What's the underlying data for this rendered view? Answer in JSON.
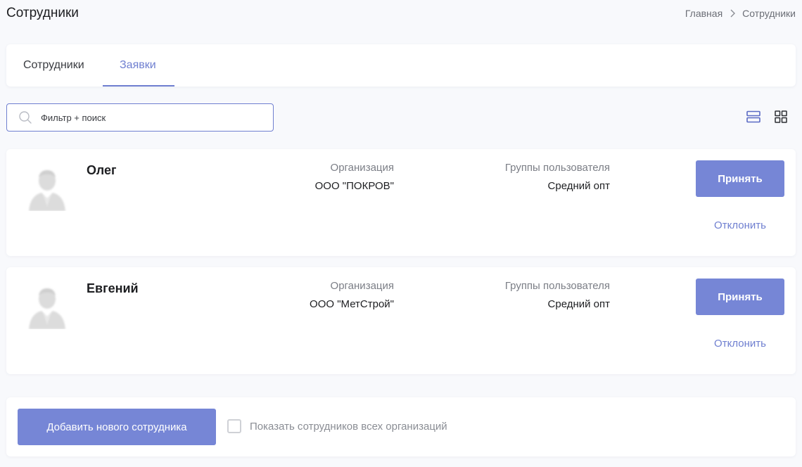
{
  "header": {
    "title": "Сотрудники",
    "breadcrumb": {
      "home": "Главная",
      "current": "Сотрудники"
    }
  },
  "tabs": [
    {
      "label": "Сотрудники",
      "active": false
    },
    {
      "label": "Заявки",
      "active": true
    }
  ],
  "search": {
    "placeholder": "Фильтр + поиск",
    "value": ""
  },
  "view_modes": {
    "list_icon": "list-view-icon",
    "grid_icon": "grid-view-icon",
    "selected": "list"
  },
  "requests": [
    {
      "name": "Олег",
      "org_label": "Организация",
      "org_value": "ООО \"ПОКРОВ\"",
      "group_label": "Группы пользователя",
      "group_value": "Средний опт",
      "accept_label": "Принять",
      "decline_label": "Отклонить"
    },
    {
      "name": "Евгений",
      "org_label": "Организация",
      "org_value": "ООО \"МетСтрой\"",
      "group_label": "Группы пользователя",
      "group_value": "Средний опт",
      "accept_label": "Принять",
      "decline_label": "Отклонить"
    }
  ],
  "footer": {
    "add_label": "Добавить нового сотрудника",
    "show_all_label": "Показать сотрудников всех организаций",
    "show_all_checked": false
  },
  "colors": {
    "accent": "#6f7fd0",
    "button": "#7686d6",
    "background": "#f8f9fc"
  }
}
